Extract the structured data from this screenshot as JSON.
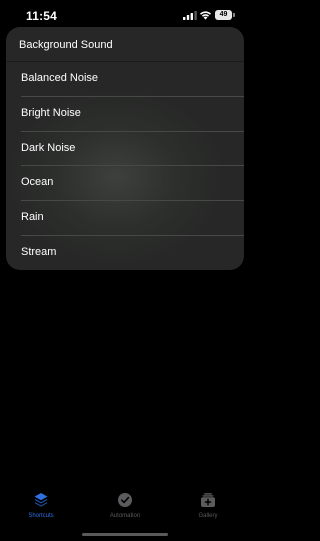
{
  "status_bar": {
    "time": "11:54",
    "battery": "49",
    "signal_icon": "cellular-signal-icon",
    "wifi_icon": "wifi-icon"
  },
  "menu": {
    "title": "Background Sound",
    "items": [
      {
        "label": "Balanced Noise"
      },
      {
        "label": "Bright Noise"
      },
      {
        "label": "Dark Noise"
      },
      {
        "label": "Ocean"
      },
      {
        "label": "Rain"
      },
      {
        "label": "Stream"
      }
    ]
  },
  "tab_bar": {
    "tabs": [
      {
        "label": "Shortcuts",
        "icon": "shortcuts-stack-icon",
        "active": true
      },
      {
        "label": "Automation",
        "icon": "clock-check-icon",
        "active": false
      },
      {
        "label": "Gallery",
        "icon": "gallery-plus-icon",
        "active": false
      }
    ]
  },
  "colors": {
    "accent": "#2f6fe0",
    "tab_inactive": "#5c5c5e",
    "menu_background": "#2d2f2d"
  }
}
